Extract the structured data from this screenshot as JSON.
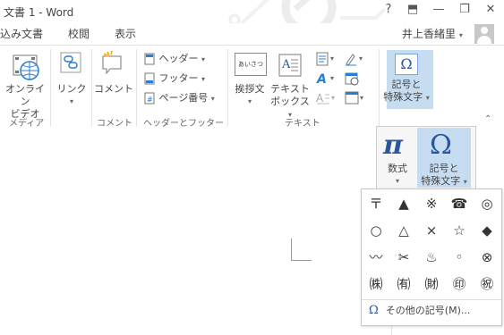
{
  "window": {
    "title": "文書 1 - Word",
    "help": "?",
    "ribbon_display": "⬒",
    "minimize": "—",
    "restore": "❐",
    "close": "✕"
  },
  "tabs": [
    {
      "label": "込み文書"
    },
    {
      "label": "校閲"
    },
    {
      "label": "表示"
    }
  ],
  "user": {
    "name": "井上香緒里",
    "caret": "▾"
  },
  "ribbon": {
    "groups": {
      "media": "メディア",
      "comment": "コメント",
      "header_footer": "ヘッダーとフッター",
      "text": "テキスト"
    },
    "buttons": {
      "online_video": [
        "オンライン",
        "ビデオ"
      ],
      "link": "リンク",
      "comment": "コメント",
      "header": "ヘッダー",
      "footer": "フッター",
      "page_number": "ページ番号",
      "greeting": "挨拶文",
      "textbox": [
        "テキスト",
        "ボックス"
      ],
      "textbox_icon": "あいさつ",
      "symbol": [
        "記号と",
        "特殊文字"
      ],
      "omega": "Ω",
      "caret": "▾"
    }
  },
  "dropdown": {
    "equation_label": "数式",
    "equation_glyph": "π",
    "symbol_label": [
      "記号と",
      "特殊文字"
    ],
    "omega": "Ω"
  },
  "gallery": {
    "symbols": [
      "〒",
      "▲",
      "※",
      "☎",
      "◎",
      "○",
      "△",
      "×",
      "☆",
      "◆",
      "〰",
      "✂",
      "♨",
      "◦",
      "⊗",
      "㈱",
      "㈲",
      "㈶",
      "㊞",
      "㊗"
    ],
    "more_label": "その他の記号(M)...",
    "more_icon": "Ω"
  },
  "colors": {
    "accent": "#2b579a",
    "active_bg": "#c5dcf1"
  }
}
